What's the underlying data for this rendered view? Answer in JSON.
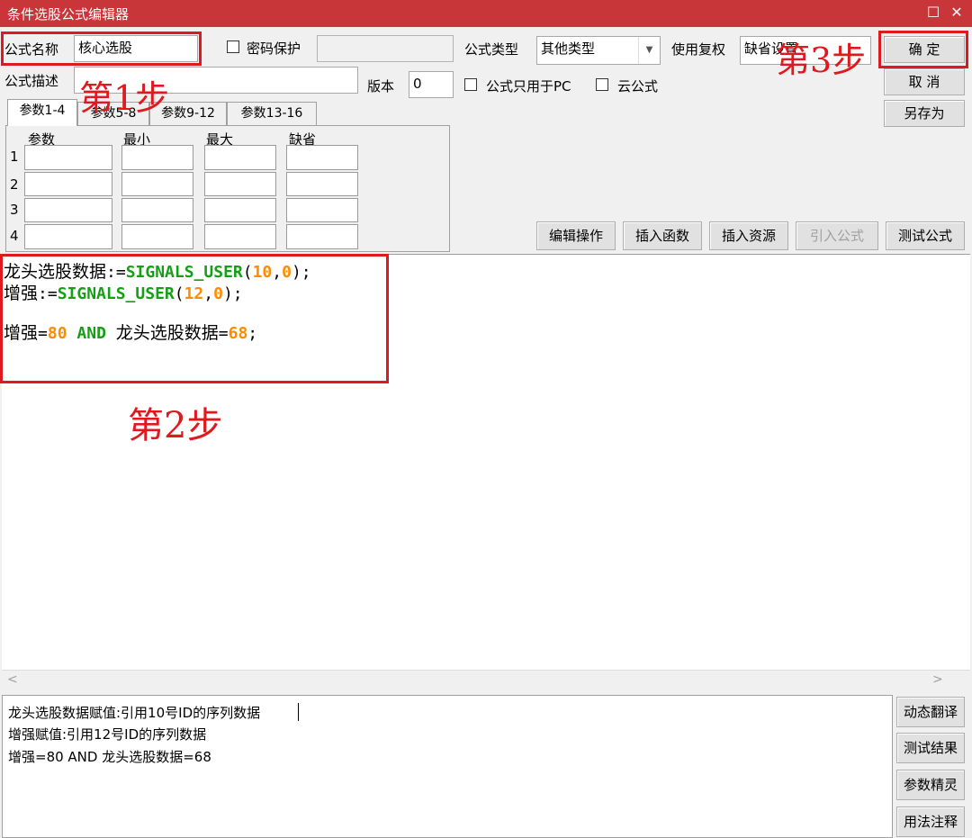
{
  "window": {
    "title": "条件选股公式编辑器",
    "maximize_icon": "☐",
    "close_icon": "✕"
  },
  "form": {
    "name_label": "公式名称",
    "name_value": "核心选股",
    "password_label": "密码保护",
    "type_label": "公式类型",
    "type_value": "其他类型",
    "fuquan_label": "使用复权",
    "fuquan_value": "缺省设置",
    "desc_label": "公式描述",
    "desc_value": "",
    "version_label": "版本",
    "version_value": "0",
    "pc_only_label": "公式只用于PC",
    "cloud_label": "云公式"
  },
  "buttons": {
    "ok": "确  定",
    "cancel": "取  消",
    "save_as": "另存为",
    "edit_ops": "编辑操作",
    "insert_func": "插入函数",
    "insert_res": "插入资源",
    "import_formula": "引入公式",
    "test_formula": "测试公式"
  },
  "tabs": [
    "参数1-4",
    "参数5-8",
    "参数9-12",
    "参数13-16"
  ],
  "param_table": {
    "headers": [
      "参数",
      "最小",
      "最大",
      "缺省"
    ],
    "rows": [
      "1",
      "2",
      "3",
      "4"
    ]
  },
  "code": {
    "l1_a": "龙头选股数据",
    "l1_b": ":=",
    "l1_fn": "SIGNALS_USER",
    "l1_p1": "(",
    "l1_n1": "10",
    "l1_c": ",",
    "l1_n2": "0",
    "l1_end": ");",
    "l2_a": "增强",
    "l2_b": ":=",
    "l2_fn": "SIGNALS_USER",
    "l2_p1": "(",
    "l2_n1": "12",
    "l2_c": ",",
    "l2_n2": "0",
    "l2_end": ");",
    "l3_a": "增强",
    "l3_eq": "=",
    "l3_n1": "80",
    "l3_kw": "AND",
    "l3_b": "龙头选股数据",
    "l3_eq2": "=",
    "l3_n2": "68",
    "l3_end": ";"
  },
  "translation": [
    "龙头选股数据赋值:引用10号ID的序列数据",
    "增强赋值:引用12号ID的序列数据",
    "增强=80 AND 龙头选股数据=68"
  ],
  "side_buttons": [
    "动态翻译",
    "测试结果",
    "参数精灵",
    "用法注释"
  ],
  "annotations": {
    "step1": "第1步",
    "step2": "第2步",
    "step3": "第3步"
  },
  "colors": {
    "titlebar": "#c9363a",
    "annotation": "#e0191f",
    "function": "#14a014",
    "number": "#ff8c00"
  }
}
